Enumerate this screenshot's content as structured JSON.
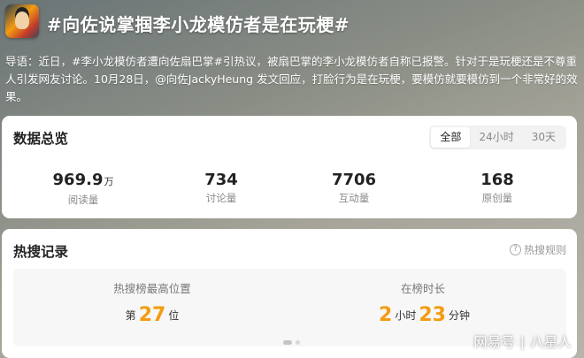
{
  "header": {
    "title": "#向佐说掌掴李小龙模仿者是在玩梗#"
  },
  "intro": {
    "text": "导语：近日，#李小龙模仿者遭向佐扇巴掌#引热议，被扇巴掌的李小龙模仿者自称已报警。针对于是玩梗还是不尊重人引发网友讨论。10月28日，@向佐JackyHeung 发文回应，打脸行为是在玩梗，要模仿就要模仿到一个非常好的效果。"
  },
  "overview": {
    "title": "数据总览",
    "tabs": [
      "全部",
      "24小时",
      "30天"
    ],
    "active_tab": "全部",
    "stats": [
      {
        "value": "969.9",
        "unit": "万",
        "label": "阅读量"
      },
      {
        "value": "734",
        "unit": "",
        "label": "讨论量"
      },
      {
        "value": "7706",
        "unit": "",
        "label": "互动量"
      },
      {
        "value": "168",
        "unit": "",
        "label": "原创量"
      }
    ]
  },
  "hot": {
    "title": "热搜记录",
    "help_label": "热搜规则",
    "rank": {
      "label": "热搜榜最高位置",
      "prefix": "第",
      "value": "27",
      "suffix": "位"
    },
    "duration": {
      "label": "在榜时长",
      "hours": "2",
      "hours_unit": "小时",
      "minutes": "23",
      "minutes_unit": "分钟"
    }
  },
  "watermark": {
    "left": "网易号",
    "separator": "|",
    "right": "八星人"
  },
  "colors": {
    "accent": "#f39c12"
  }
}
